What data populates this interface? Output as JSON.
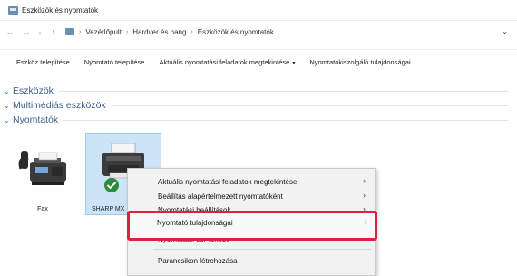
{
  "window": {
    "title": "Eszközök és nyomtatók"
  },
  "address": {
    "breadcrumb": [
      "Vezérlőpult",
      "Hardver és hang",
      "Eszközök és nyomtatók"
    ],
    "sep": "›"
  },
  "commands": {
    "add_device": "Eszköz telepítése",
    "add_printer": "Nyomtató telepítése",
    "see_print_jobs": "Aktuális nyomtatási feladatok megtekintése",
    "print_server_props": "Nyomtatókiszolgáló tulajdonságai"
  },
  "groups": {
    "devices": "Eszközök",
    "multimedia": "Multimédiás eszközök",
    "printers": "Nyomtatók"
  },
  "printers": [
    {
      "label": "Fax"
    },
    {
      "label": "SHARP MX"
    }
  ],
  "context_menu": {
    "items": [
      {
        "label": "Aktuális nyomtatási feladatok megtekintése",
        "has_submenu": true
      },
      {
        "label": "Beállítás alapértelmezett nyomtatóként",
        "has_submenu": true
      },
      {
        "label": "Nyomtatási beállítások",
        "has_submenu": true
      },
      {
        "label": "Nyomtató tulajdonságai",
        "has_submenu": true,
        "highlighted": true
      },
      {
        "label": "Nyomtatási sor törlése",
        "has_submenu": true
      },
      {
        "label": "Parancsikon létrehozása",
        "has_submenu": false
      }
    ],
    "arrow": "›"
  },
  "colors": {
    "highlight_border": "#d9233f",
    "selection": "#cce4f7",
    "group_title": "#3b5f8c"
  }
}
